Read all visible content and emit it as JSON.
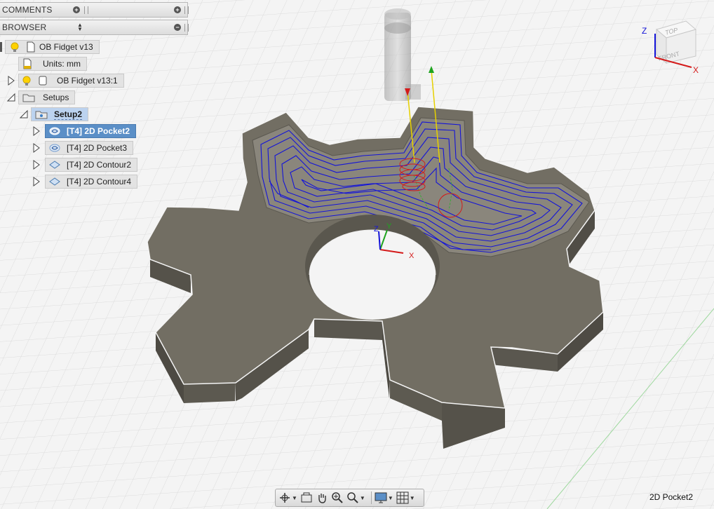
{
  "panels": {
    "comments_title": "COMMENTS",
    "browser_title": "BROWSER"
  },
  "tree": {
    "root": "OB Fidget v13",
    "units": "Units: mm",
    "component": "OB Fidget v13:1",
    "setups": "Setups",
    "setup": "Setup2",
    "operations": [
      "[T4] 2D Pocket2",
      "[T4] 2D Pocket3",
      "[T4] 2D Contour2",
      "[T4] 2D Contour4"
    ]
  },
  "viewcube": {
    "top": "TOP",
    "front": "FRONT",
    "x": "X",
    "z": "Z"
  },
  "triad": {
    "x": "X",
    "y": "Y",
    "z": "Z"
  },
  "status": {
    "operation": "2D Pocket2"
  },
  "icons": {
    "orbit": "orbit-icon",
    "pan": "pan-icon",
    "zoom": "zoom-icon",
    "fit": "zoom-fit-icon",
    "display": "display-settings-icon",
    "grid": "grid-icon",
    "bulb": "lightbulb-icon"
  },
  "colors": {
    "toolpath": "#1414d8",
    "part": "#6e6a60",
    "selected": "#5b8fc7"
  }
}
